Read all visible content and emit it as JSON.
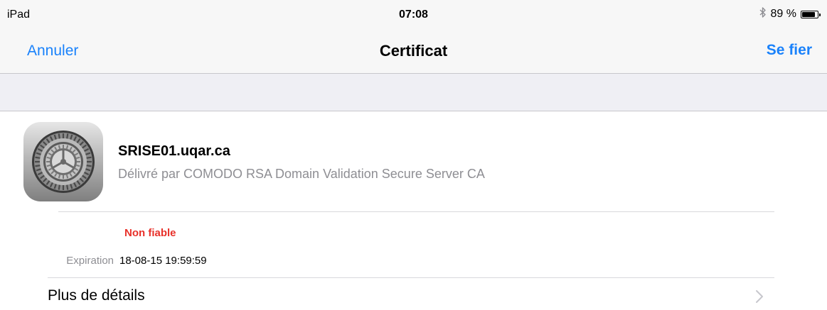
{
  "status_bar": {
    "carrier": "iPad",
    "time": "07:08",
    "bluetooth_icon": "bluetooth-icon",
    "battery_percent": "89 %",
    "battery_level": 0.89
  },
  "nav": {
    "cancel_label": "Annuler",
    "title": "Certificat",
    "trust_label": "Se fier",
    "accent_color": "#1a82fb"
  },
  "certificate": {
    "icon": "settings-gear-icon",
    "name": "SRISE01.uqar.ca",
    "issuer": "Délivré par COMODO RSA Domain Validation Secure Server CA",
    "trust_status": "Non fiable",
    "trust_status_color": "#e8312a",
    "expiration_label": "Expiration",
    "expiration_value": "18-08-15 19:59:59"
  },
  "details": {
    "label": "Plus de détails",
    "chevron_icon": "chevron-right-icon"
  }
}
